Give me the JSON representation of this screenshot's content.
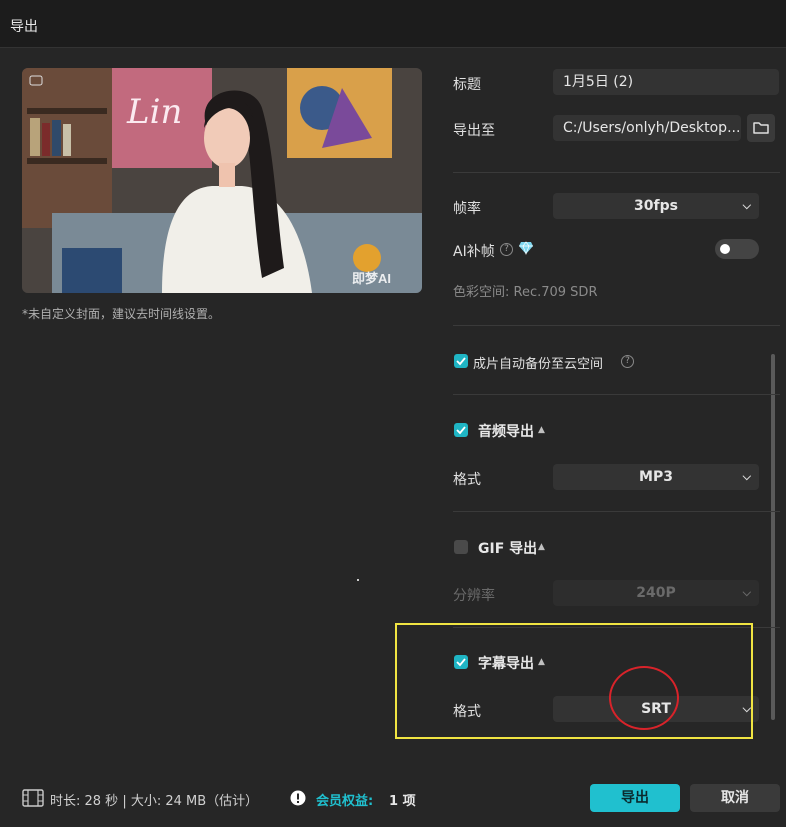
{
  "window": {
    "title": "导出"
  },
  "preview": {
    "watermark": "即梦AI",
    "sign_text": "Lin",
    "note": "*未自定义封面，建议去时间线设置。"
  },
  "settings": {
    "title_label": "标题",
    "title_value": "1月5日 (2)",
    "export_to_label": "导出至",
    "export_to_value": "C:/Users/onlyh/Desktop...",
    "framerate_label": "帧率",
    "framerate_value": "30fps",
    "ai_interp_label": "AI补帧",
    "color_space": "色彩空间:  Rec.709 SDR",
    "cloud_backup_label": "成片自动备份至云空间",
    "audio_title": "音频导出",
    "audio_format_label": "格式",
    "audio_format_value": "MP3",
    "gif_title": "GIF 导出",
    "gif_resolution_label": "分辨率",
    "gif_resolution_value": "240P",
    "subtitle_title": "字幕导出",
    "subtitle_format_label": "格式",
    "subtitle_format_value": "SRT"
  },
  "states": {
    "ai_interp": false,
    "cloud_backup": true,
    "audio_export": true,
    "gif_export": false,
    "subtitle_export": true
  },
  "footer": {
    "duration_size": "时长:  28 秒 | 大小:  24 MB（估计）",
    "member_label": "会员权益:",
    "member_count": "1 项",
    "export_button": "导出",
    "cancel_button": "取消"
  },
  "colors": {
    "accent": "#20c0cf",
    "highlight_box": "#f0e442",
    "annotation_circle": "#d8232a"
  }
}
